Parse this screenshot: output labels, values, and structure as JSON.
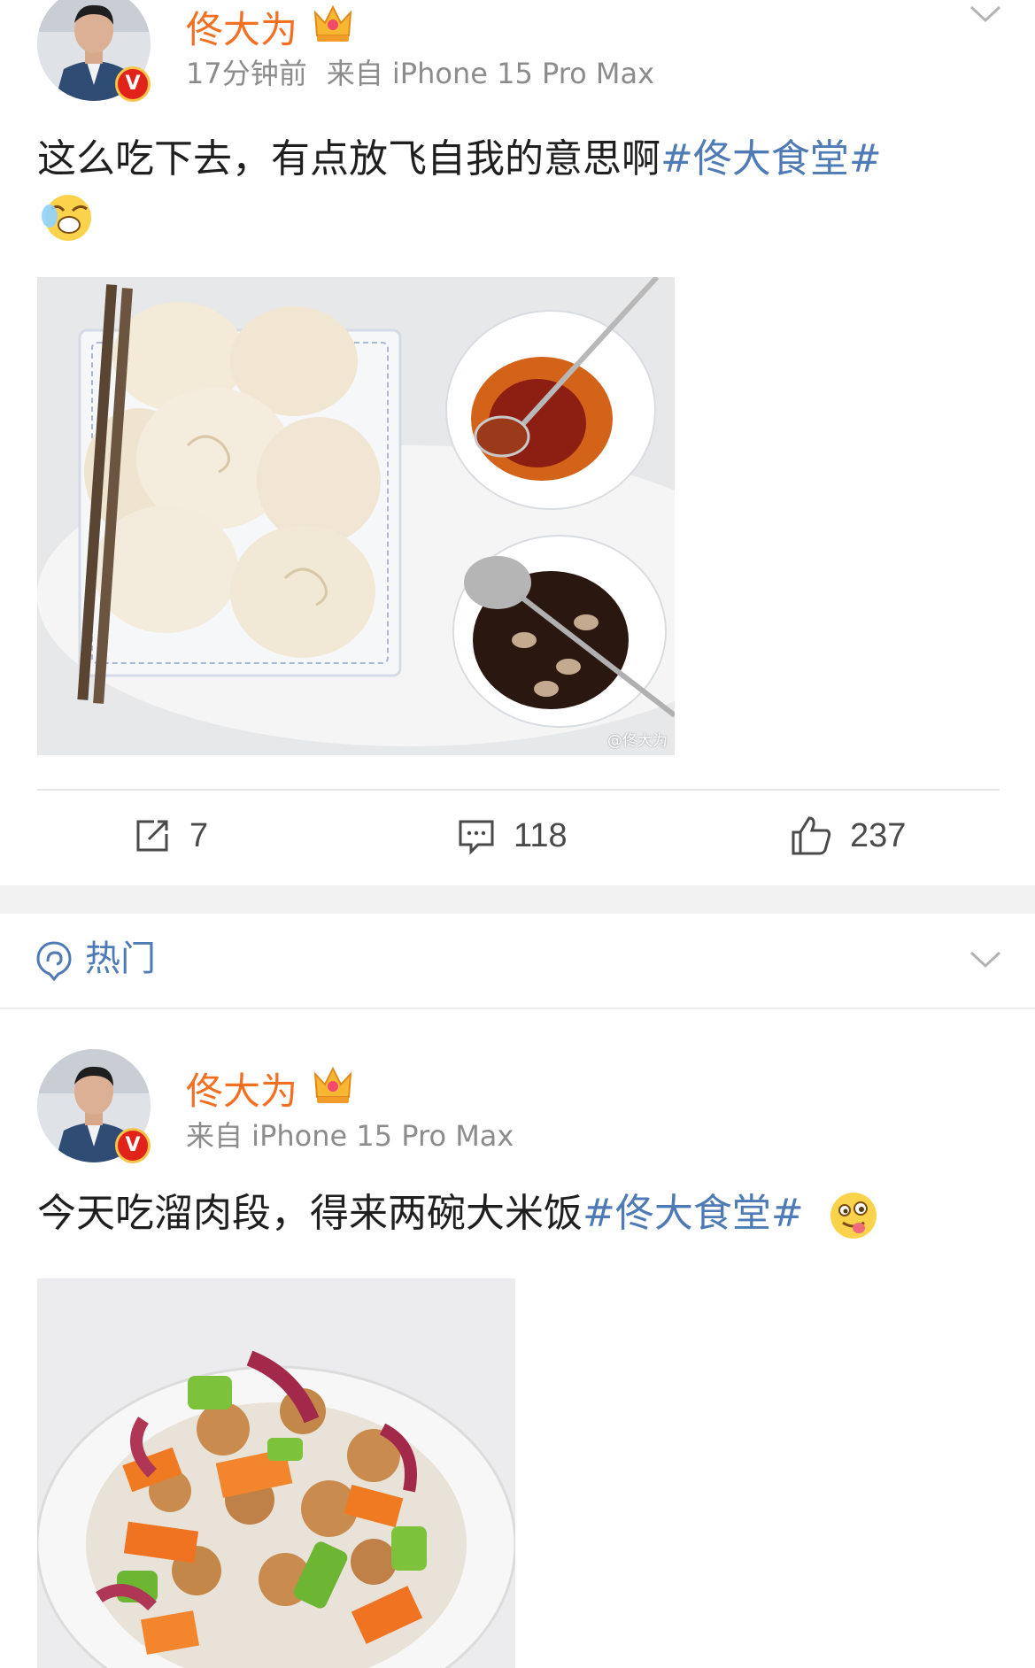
{
  "posts": [
    {
      "username": "佟大为",
      "time": "17分钟前",
      "source": "来自 iPhone 15 Pro Max",
      "text": "这么吃下去，有点放飞自我的意思啊",
      "topic": "#佟大食堂#",
      "emoji": "laughing-tears-emoji",
      "image_watermark": "@佟大为",
      "image_subject": "steamed-buns-photo",
      "actions": {
        "repost": "7",
        "comment": "118",
        "like": "237"
      }
    },
    {
      "username": "佟大为",
      "time": "",
      "source": "来自 iPhone 15 Pro Max",
      "text": "今天吃溜肉段，得来两碗大米饭",
      "topic": "#佟大食堂#",
      "emoji": "tongue-out-emoji",
      "image_subject": "stir-fried-pork-photo"
    }
  ],
  "filter": {
    "label": "热门"
  },
  "colors": {
    "username": "#f36f21",
    "topic": "#4e7ab5",
    "meta": "#8c8c8c",
    "badge": "#e2231a"
  }
}
